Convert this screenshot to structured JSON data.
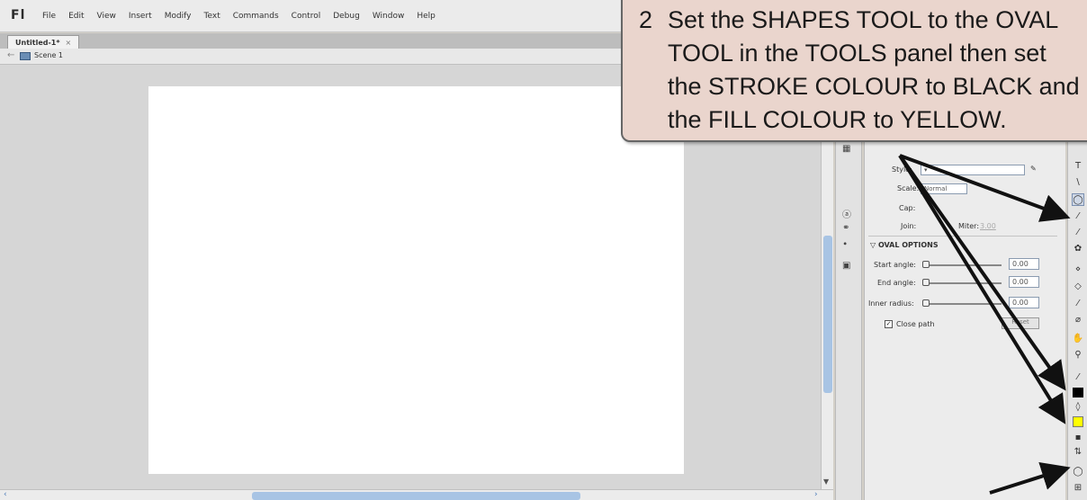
{
  "app": {
    "logo": "Fl"
  },
  "menu": [
    "File",
    "Edit",
    "View",
    "Insert",
    "Modify",
    "Text",
    "Commands",
    "Control",
    "Debug",
    "Window",
    "Help"
  ],
  "document": {
    "tab_label": "Untitled-1*",
    "tab_close": "×",
    "scene_label": "Scene 1"
  },
  "properties": {
    "stroke_style_label": "Style:",
    "scale_label": "Scale:",
    "scale_value": "Normal",
    "cap_label": "Cap:",
    "join_label": "Join:",
    "miter_label": "Miter:",
    "miter_value": "3.00",
    "oval_options_header": "OVAL OPTIONS",
    "start_angle_label": "Start angle:",
    "start_angle_value": "0.00",
    "end_angle_label": "End angle:",
    "end_angle_value": "0.00",
    "inner_radius_label": "Inner radius:",
    "inner_radius_value": "0.00",
    "close_path_label": "Close path",
    "close_path_checked": true,
    "reset_label": "Reset"
  },
  "tools": {
    "stroke_color": "#000000",
    "fill_color": "#ffff00"
  },
  "callout": {
    "number": "2",
    "lines": [
      "Set the SHAPES TOOL to the OVAL",
      "TOOL in the TOOLS panel then set",
      "the STROKE COLOUR to BLACK and",
      "the FILL COLOUR to YELLOW."
    ]
  }
}
